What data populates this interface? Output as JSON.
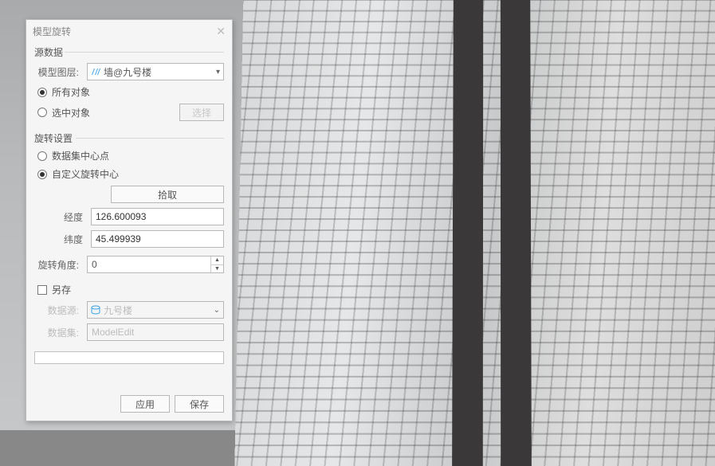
{
  "dialog": {
    "title": "模型旋转",
    "sections": {
      "source": {
        "label": "源数据",
        "modelLayer": {
          "label": "模型图层:",
          "value": "墙@九号楼"
        },
        "allObjects": "所有对象",
        "selectedObjects": "选中对象",
        "selectBtn": "选择"
      },
      "rotation": {
        "label": "旋转设置",
        "datasetCenter": "数据集中心点",
        "customCenter": "自定义旋转中心",
        "pickBtn": "拾取",
        "longitude": {
          "label": "经度",
          "value": "126.600093"
        },
        "latitude": {
          "label": "纬度",
          "value": "45.499939"
        },
        "angle": {
          "label": "旋转角度:",
          "value": "0"
        }
      },
      "saveAs": {
        "label": "另存",
        "datasource": {
          "label": "数据源:",
          "value": "九号楼"
        },
        "dataset": {
          "label": "数据集:",
          "value": "ModelEdit"
        }
      }
    },
    "footer": {
      "apply": "应用",
      "save": "保存"
    }
  }
}
